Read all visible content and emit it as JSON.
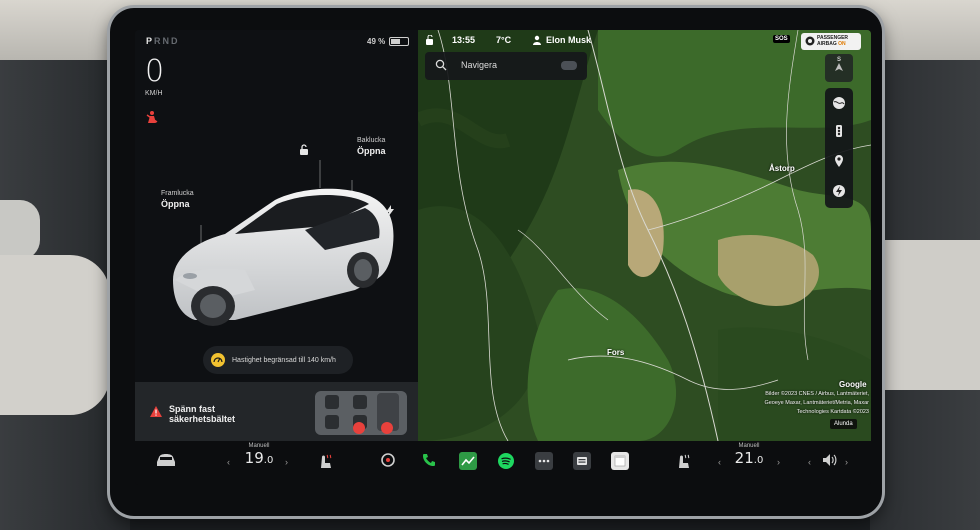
{
  "status": {
    "gear": {
      "p": "P",
      "r": "R",
      "n": "N",
      "d": "D"
    },
    "battery": "49 %",
    "speed": "0",
    "speed_unit": "KM/H"
  },
  "top_bar": {
    "time": "13:55",
    "temperature": "7°C",
    "user": "Elon Musk",
    "sos": "SOS",
    "airbag_line1": "PASSENGER",
    "airbag_line2": "AIRBAG",
    "airbag_state": "ON"
  },
  "car": {
    "front_trunk_label": "Framlucka",
    "front_trunk_action": "Öppna",
    "rear_trunk_label": "Baklucka",
    "rear_trunk_action": "Öppna",
    "speed_limit_notice": "Hastighet begränsad till 140 km/h"
  },
  "alert": {
    "text_line1": "Spänn fast",
    "text_line2": "säkerhetsbältet"
  },
  "map": {
    "search_placeholder": "Navigera",
    "compass": "S",
    "places": {
      "north": "Åstorp",
      "south": "Fors"
    },
    "google": "Google",
    "attribution_lines": [
      "Bilder ©2023 CNES / Airbus, Lantmäteriet,",
      "Geoeye Maxar, Lantmäteriet/Metria, Maxar",
      "Technologies Kartdata ©2023"
    ],
    "place_chip": "Alunda"
  },
  "climate": {
    "driver_mode": "Manuell",
    "driver_temp_int": "19",
    "driver_temp_dec": ".0",
    "passenger_mode": "Manuell",
    "passenger_temp_int": "21",
    "passenger_temp_dec": ".0"
  },
  "colors": {
    "accent_red": "#e8413c",
    "spotify": "#1ed760",
    "phone": "#29c24a",
    "warning_yellow": "#f2c230"
  }
}
